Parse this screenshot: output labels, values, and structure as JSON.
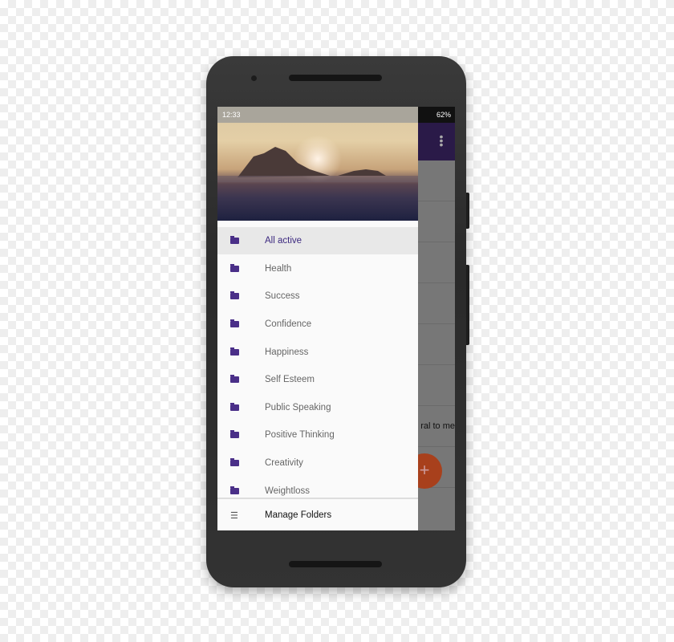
{
  "status": {
    "time": "12:33",
    "battery": "62%"
  },
  "background": {
    "partial_text": "ral to me",
    "fab_icon": "plus-icon"
  },
  "drawer": {
    "items": [
      {
        "label": "All active",
        "active": true
      },
      {
        "label": "Health"
      },
      {
        "label": "Success"
      },
      {
        "label": "Confidence"
      },
      {
        "label": "Happiness"
      },
      {
        "label": "Self Esteem"
      },
      {
        "label": "Public Speaking"
      },
      {
        "label": "Positive Thinking"
      },
      {
        "label": "Creativity"
      },
      {
        "label": "Weightloss"
      }
    ],
    "footer": {
      "label": "Manage Folders",
      "icon": "list-icon"
    }
  },
  "colors": {
    "accent": "#3d2a80",
    "toolbar": "#2a1a48",
    "fab": "#a8401c"
  }
}
